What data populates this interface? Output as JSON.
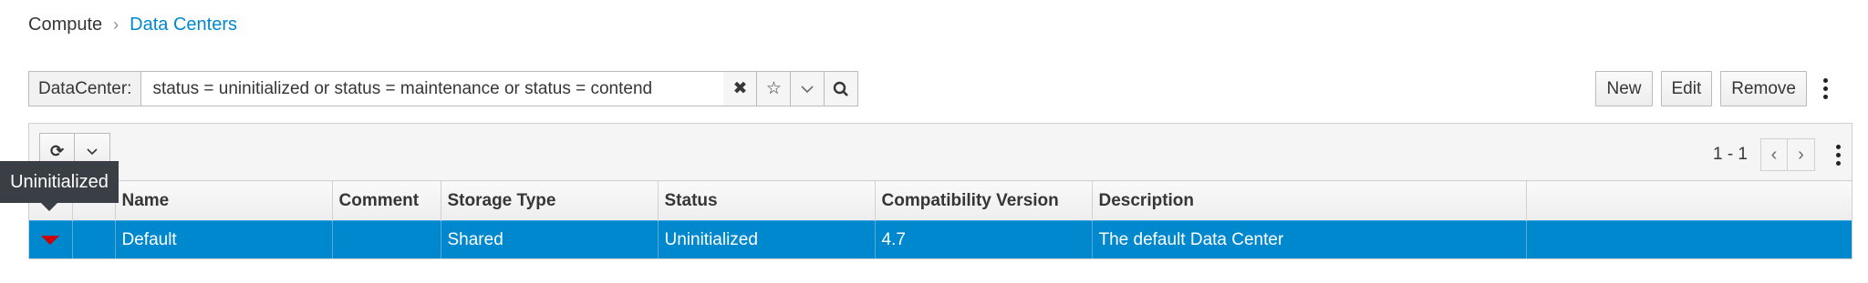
{
  "breadcrumb": {
    "parent": "Compute",
    "current": "Data Centers"
  },
  "search": {
    "label": "DataCenter:",
    "query": "status = uninitialized or status = maintenance or status = contend"
  },
  "icons": {
    "clear": "✖",
    "bookmark": "☆",
    "dropdown": "⌵",
    "search": "🔍",
    "refresh": "⟳",
    "prev": "‹",
    "next": "›"
  },
  "actions": {
    "new": "New",
    "edit": "Edit",
    "remove": "Remove"
  },
  "pager": {
    "range": "1 - 1"
  },
  "table": {
    "columns": [
      "",
      "",
      "Name",
      "Comment",
      "Storage Type",
      "Status",
      "Compatibility Version",
      "Description",
      ""
    ],
    "rows": [
      {
        "name": "Default",
        "comment": "",
        "storage_type": "Shared",
        "status": "Uninitialized",
        "compat_version": "4.7",
        "description": "The default Data Center"
      }
    ]
  },
  "tooltip": {
    "text": "Uninitialized"
  },
  "colors": {
    "accent": "#0088ce",
    "status_down": "#cc0000"
  }
}
